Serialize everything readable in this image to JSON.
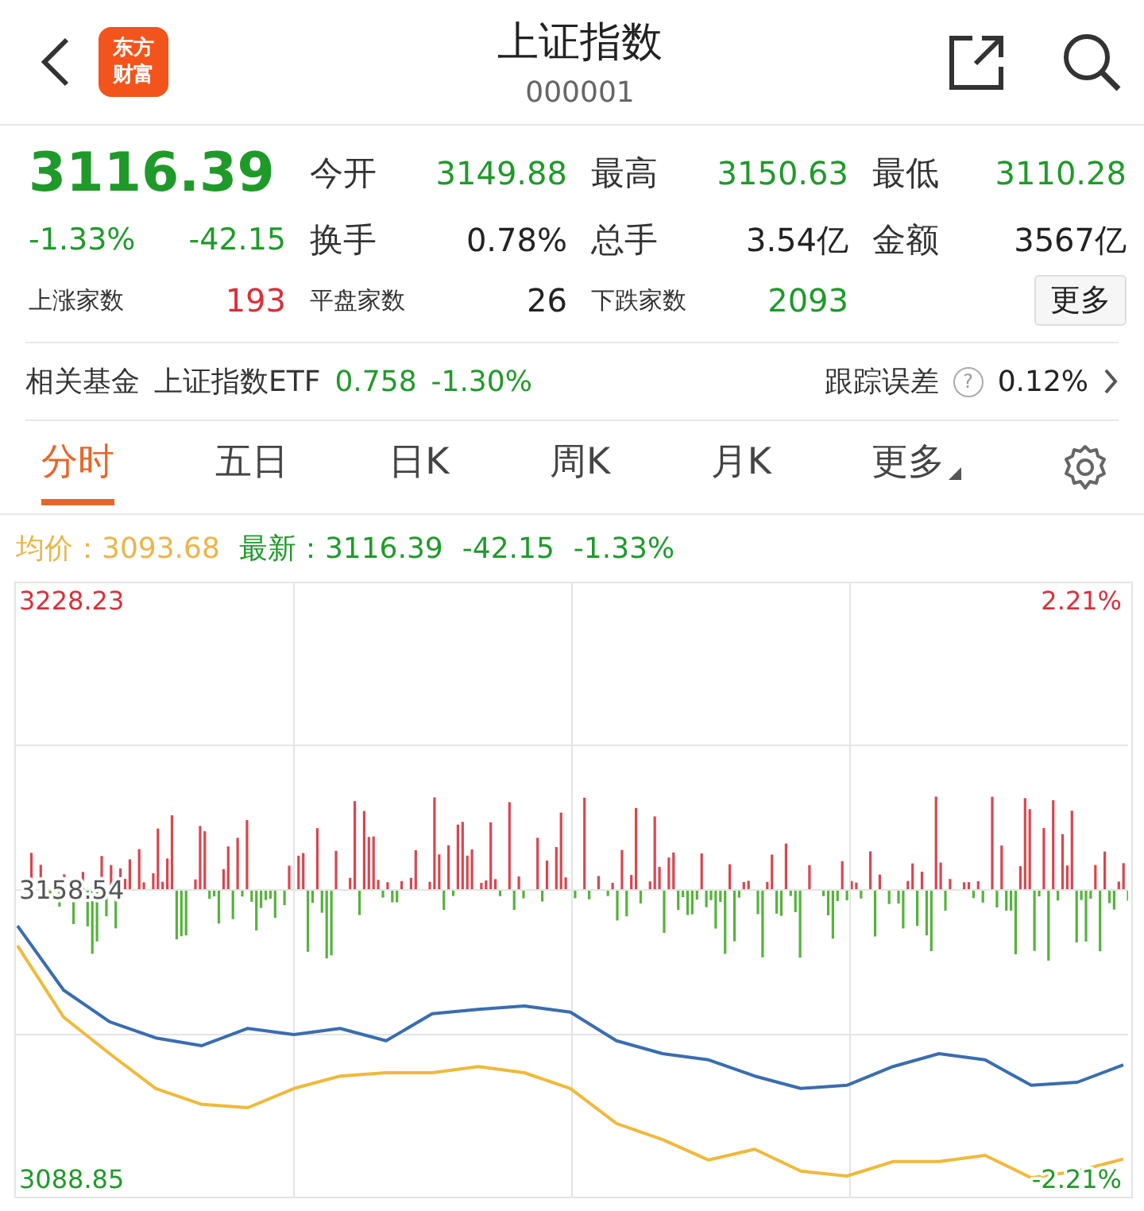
{
  "header": {
    "logo_lines": [
      "东方",
      "财富"
    ],
    "title": "上证指数",
    "code": "000001"
  },
  "quote": {
    "price": "3116.39",
    "change_pct": "-1.33%",
    "change": "-42.15",
    "color": "#1f9a2a"
  },
  "stats": [
    {
      "label": "今开",
      "value": "3149.88",
      "color": "#1f9a2a"
    },
    {
      "label": "最高",
      "value": "3150.63",
      "color": "#1f9a2a"
    },
    {
      "label": "最低",
      "value": "3110.28",
      "color": "#1f9a2a"
    },
    {
      "label": "换手",
      "value": "0.78%",
      "color": "#222222"
    },
    {
      "label": "总手",
      "value": "3.54亿",
      "color": "#222222"
    },
    {
      "label": "金额",
      "value": "3567亿",
      "color": "#222222"
    }
  ],
  "breadth": [
    {
      "label": "上涨家数",
      "value": "193",
      "color": "#d9303a"
    },
    {
      "label": "平盘家数",
      "value": "26",
      "color": "#222222"
    },
    {
      "label": "下跌家数",
      "value": "2093",
      "color": "#1f9a2a"
    }
  ],
  "more_button": "更多",
  "fund": {
    "label": "相关基金",
    "name": "上证指数ETF",
    "price": "0.758",
    "change": "-1.30%",
    "color": "#1f9a2a",
    "tracking_label": "跟踪误差",
    "help": "?",
    "tracking_value": "0.12%"
  },
  "tabs": [
    {
      "label": "分时",
      "selected": true,
      "kind": "plain"
    },
    {
      "label": "五日",
      "selected": false,
      "kind": "plain"
    },
    {
      "label": "日K",
      "selected": false,
      "kind": "plain"
    },
    {
      "label": "周K",
      "selected": false,
      "kind": "plain"
    },
    {
      "label": "月K",
      "selected": false,
      "kind": "plain"
    },
    {
      "label": "更多",
      "selected": false,
      "kind": "dropdown"
    }
  ],
  "legend": {
    "separator": "：",
    "avg_value": "3093.68",
    "last_value": "3116.39",
    "last_change": "-42.15",
    "last_pct": "-1.33%"
  },
  "chart": {
    "right_labels": [
      "2.21%",
      "-2.21%"
    ],
    "chart_data": {
      "type": "line",
      "categories": [
        null,
        null,
        null,
        null,
        null,
        null,
        null,
        null,
        null,
        null,
        null,
        null,
        null,
        null,
        null,
        null,
        null,
        null,
        null,
        null,
        null,
        null,
        null,
        null,
        null
      ],
      "series": [
        {
          "name": "最新",
          "color": "#3a6db0",
          "values": [
            3149.9,
            3134.4,
            3126.8,
            3122.9,
            3121.0,
            3125.2,
            3123.7,
            3125.2,
            3122.2,
            3128.7,
            3129.8,
            3130.6,
            3129.1,
            3122.2,
            3119.1,
            3117.6,
            3113.7,
            3110.7,
            3111.5,
            3116.0,
            3119.1,
            3117.6,
            3111.5,
            3112.2,
            3116.4
          ]
        },
        {
          "name": "均价",
          "color": "#f0b93a",
          "values": [
            3145.1,
            3127.9,
            3119.1,
            3110.7,
            3106.9,
            3106.1,
            3110.7,
            3113.7,
            3114.5,
            3114.5,
            3116.0,
            3114.5,
            3110.7,
            3102.3,
            3098.4,
            3093.5,
            3096.1,
            3090.8,
            3089.6,
            3093.1,
            3093.1,
            3094.6,
            3089.2,
            3090.8,
            3093.7
          ]
        }
      ],
      "grid": true,
      "ylim": [
        3084.64,
        3232.44
      ],
      "yticks": [
        {
          "value": 3228.23,
          "label": "3228.23"
        },
        {
          "value": 3158.54,
          "label": "3158.54"
        },
        {
          "value": 3088.85,
          "label": "3088.85"
        }
      ]
    }
  }
}
